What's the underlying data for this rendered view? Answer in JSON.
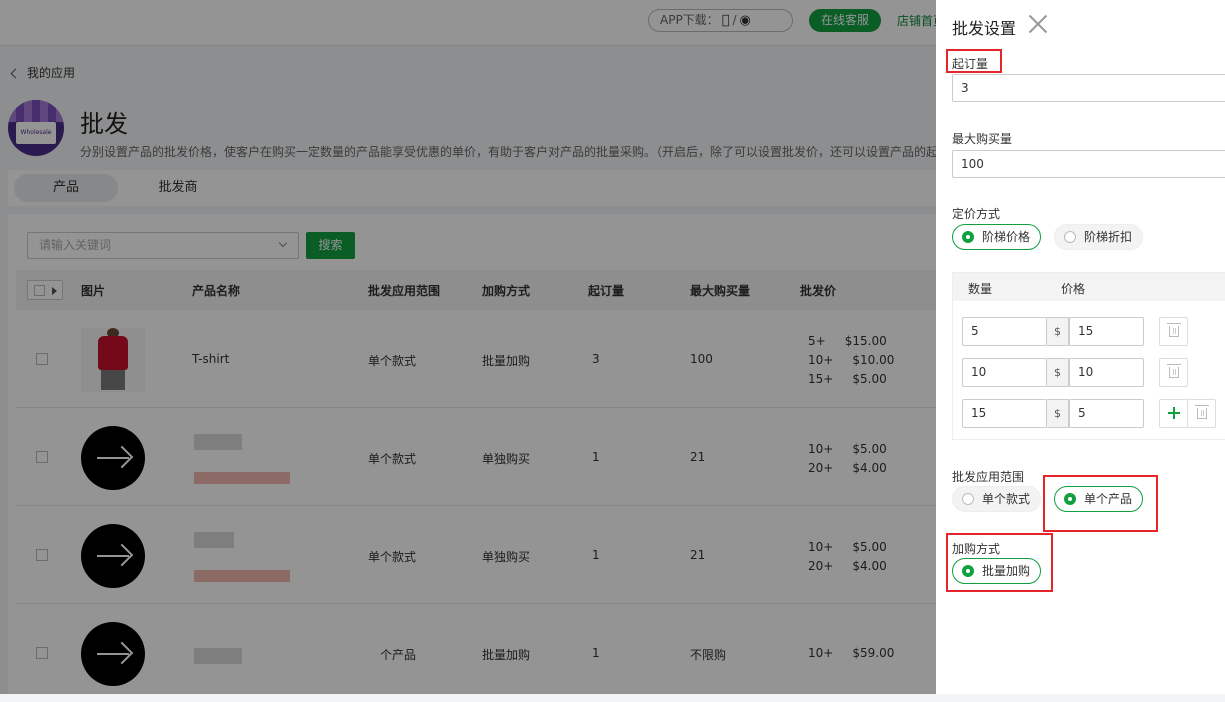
{
  "topbar": {
    "app_download_label": "APP下载：",
    "app_download_sep": "/",
    "online_service": "在线客服",
    "shop_home": "店铺首页"
  },
  "header": {
    "back_label": "我的应用",
    "app_logo_text": "Wholesale",
    "title": "批发",
    "description": "分别设置产品的批发价格，使客户在购买一定数量的产品能享受优惠的单价，有助于客户对产品的批量采购。（开启后，除了可以设置批发价，还可以设置产品的起订量和最大购买量）"
  },
  "tabs": [
    {
      "label": "产品",
      "active": true
    },
    {
      "label": "批发商",
      "active": false
    }
  ],
  "search": {
    "placeholder": "请输入关键词",
    "button_label": "搜索"
  },
  "table": {
    "columns": [
      "图片",
      "产品名称",
      "批发应用范围",
      "加购方式",
      "起订量",
      "最大购买量",
      "批发价"
    ],
    "rows": [
      {
        "name": "T-shirt",
        "scope": "单个款式",
        "method": "批量加购",
        "moq": "3",
        "max": "100",
        "prices": "5+     $15.00\n10+     $10.00\n15+     $5.00"
      },
      {
        "name": "",
        "scope": "单个款式",
        "method": "单独购买",
        "moq": "1",
        "max": "21",
        "prices": "10+     $5.00\n20+     $4.00"
      },
      {
        "name": "",
        "scope": "单个款式",
        "method": "单独购买",
        "moq": "1",
        "max": "21",
        "prices": "10+     $5.00\n20+     $4.00"
      },
      {
        "name": "",
        "scope": "个产品",
        "method": "批量加购",
        "moq": "1",
        "max": "不限购",
        "prices": "10+     $59.00"
      }
    ]
  },
  "drawer": {
    "title": "批发设置",
    "moq_label": "起订量",
    "moq_value": "3",
    "max_label": "最大购买量",
    "max_value": "100",
    "pricing_label": "定价方式",
    "pricing_options": [
      "阶梯价格",
      "阶梯折扣"
    ],
    "tier_headers": {
      "qty": "数量",
      "price": "价格"
    },
    "currency": "$",
    "tiers": [
      {
        "qty": "5",
        "price": "15"
      },
      {
        "qty": "10",
        "price": "10"
      },
      {
        "qty": "15",
        "price": "5"
      }
    ],
    "scope_label": "批发应用范围",
    "scope_options": [
      "单个款式",
      "单个产品"
    ],
    "method_label": "加购方式",
    "method_option": "批量加购"
  },
  "colors": {
    "accent": "#10a040",
    "highlight": "#e4262a"
  },
  "icons": [
    "apple-icon",
    "android-icon",
    "close-icon",
    "trash-icon",
    "plus-icon",
    "chevron-left-icon"
  ]
}
